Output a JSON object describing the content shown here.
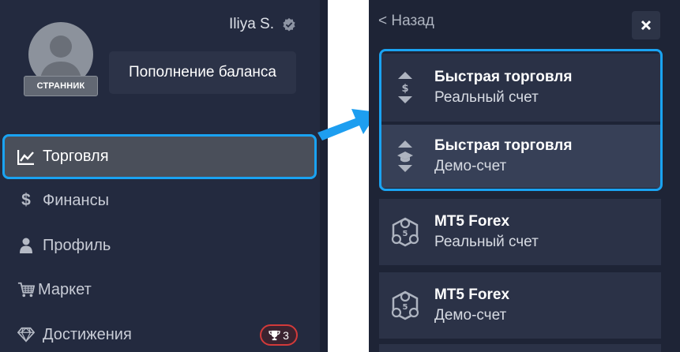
{
  "profile": {
    "username": "Iliya S.",
    "status_badge": "СТРАННИК",
    "deposit_label": "Пополнение баланса"
  },
  "menu": {
    "items": [
      {
        "label": "Торговля",
        "icon": "chart-line-icon"
      },
      {
        "label": "Финансы",
        "icon": "dollar-icon"
      },
      {
        "label": "Профиль",
        "icon": "user-icon"
      },
      {
        "label": "Маркет",
        "icon": "cart-icon"
      },
      {
        "label": "Достижения",
        "icon": "diamond-icon"
      }
    ],
    "achievements_count": "3"
  },
  "trade_panel": {
    "back_label": "< Назад",
    "accounts": [
      {
        "title": "Быстрая торговля",
        "subtitle": "Реальный счет",
        "icon": "quick-trade-real-icon"
      },
      {
        "title": "Быстрая торговля",
        "subtitle": "Демо-счет",
        "icon": "quick-trade-demo-icon"
      },
      {
        "title": "MT5 Forex",
        "subtitle": "Реальный счет",
        "icon": "mt5-icon"
      },
      {
        "title": "MT5 Forex",
        "subtitle": "Демо-счет",
        "icon": "mt5-icon"
      }
    ]
  },
  "colors": {
    "highlight": "#1aa3f2",
    "sidebar_bg": "#232a3f",
    "panel_bg": "#1e2436",
    "achievement_border": "#d23a3a"
  }
}
